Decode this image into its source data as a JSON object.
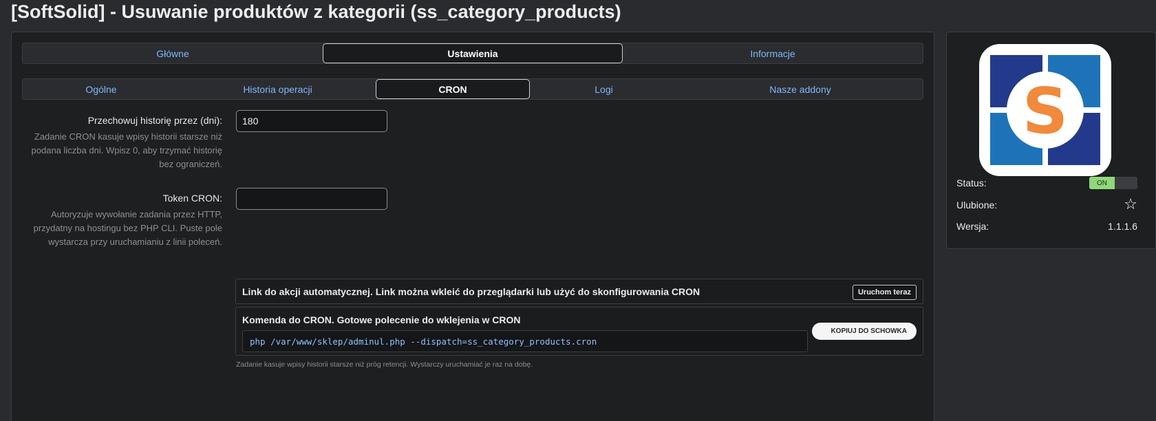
{
  "page": {
    "title": "[SoftSolid] - Usuwanie produktów z kategorii (ss_category_products)"
  },
  "main_tabs": [
    {
      "label": "Główne",
      "active": false
    },
    {
      "label": "Ustawienia",
      "active": true
    },
    {
      "label": "Informacje",
      "active": false
    }
  ],
  "sub_tabs": [
    {
      "label": "Ogólne",
      "active": false
    },
    {
      "label": "Historia operacji",
      "active": false
    },
    {
      "label": "CRON",
      "active": true
    },
    {
      "label": "Logi",
      "active": false
    },
    {
      "label": "Nasze addony",
      "active": false
    }
  ],
  "fields": {
    "history": {
      "label": "Przechowuj historię przez (dni):",
      "help": "Zadanie CRON kasuje wpisy historii starsze niż podana liczba dni. Wpisz 0, aby trzymać historię bez ograniczeń.",
      "value": "180"
    },
    "token": {
      "label": "Token CRON:",
      "help": "Autoryzuje wywołanie zadania przez HTTP, przydatny na hostingu bez PHP CLI. Puste pole wystarcza przy uruchamianiu z linii poleceń.",
      "value": ""
    }
  },
  "cron": {
    "link_title": "Link do akcji automatycznej. Link można wkleić do przeglądarki lub użyć do skonfigurowania CRON",
    "run_button": "Uruchom teraz",
    "command_title": "Komenda do CRON. Gotowe polecenie do wklejenia w CRON",
    "command": "php /var/www/sklep/adminul.php --dispatch=ss_category_products.cron",
    "copy_button": "KOPIUJ DO SCHOWKA",
    "footnote": "Zadanie kasuje wpisy historii starsze niż próg retencji. Wystarczy uruchamiać je raz na dobę."
  },
  "sidebar": {
    "status_label": "Status:",
    "status_value": "ON",
    "favorite_label": "Ulubione:",
    "favorite_icon": "star-outline-icon",
    "version_label": "Wersja:",
    "version_value": "1.1.1.6"
  },
  "colors": {
    "link_blue": "#7fb7ff",
    "status_on": "#8fd97a",
    "logo_orange": "#f08a3c",
    "logo_blue_dark": "#233a8c",
    "logo_blue_light": "#1e73b8"
  }
}
